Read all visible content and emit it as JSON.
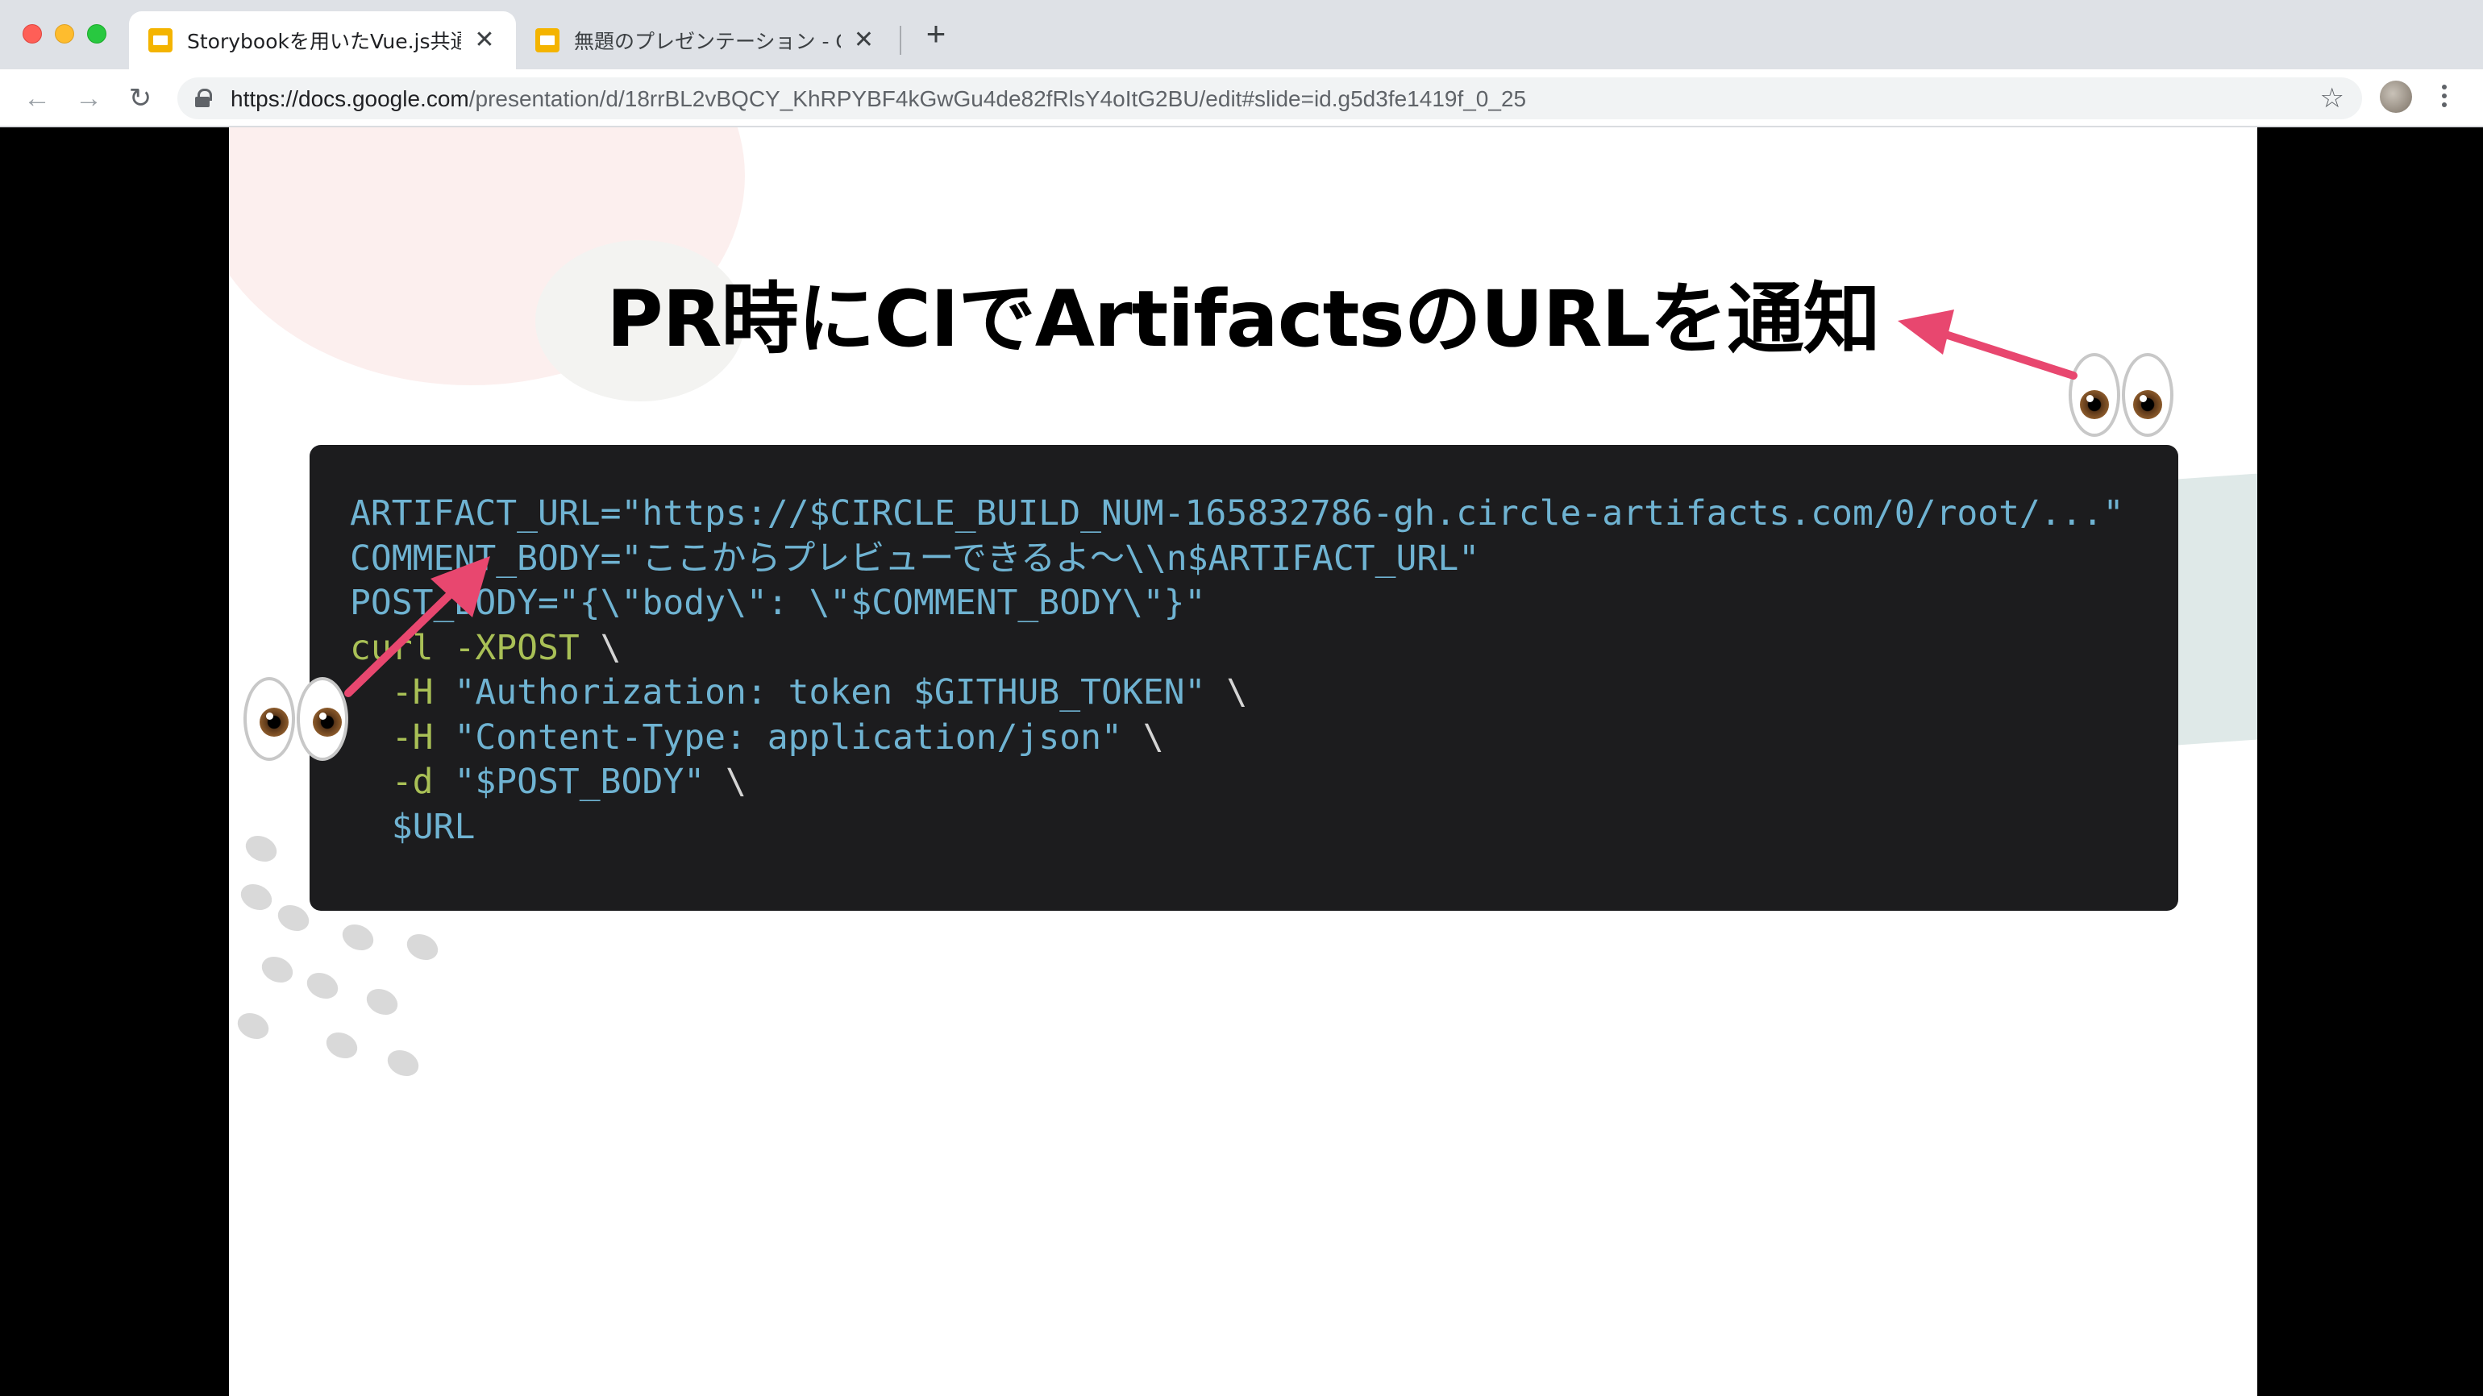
{
  "browser": {
    "tabs": [
      {
        "title": "Storybookを用いたVue.js共通コ",
        "active": true
      },
      {
        "title": "無題のプレゼンテーション - Goog",
        "active": false
      }
    ],
    "tab_close_glyph": "✕",
    "new_tab_glyph": "+",
    "url_host": "https://docs.google.com",
    "url_path": "/presentation/d/18rrBL2vBQCY_KhRPYBF4kGwGu4de82fRlsY4oItG2BU/edit#slide=id.g5d3fe1419f_0_25",
    "nav": {
      "back_icon": "←",
      "forward_icon": "→",
      "reload_icon": "↻",
      "star_icon": "☆"
    }
  },
  "slide": {
    "title": "PR時にCIでArtifactsのURLを通知",
    "code_lines": [
      [
        {
          "t": "ARTIFACT_URL=\"https://$CIRCLE_BUILD_NUM-165832786-gh.circle-artifacts.com/0/root/...\"",
          "c": "str"
        }
      ],
      [
        {
          "t": "COMMENT_BODY=\"ここからプレビューできるよ〜\\\\n$ARTIFACT_URL\"",
          "c": "str"
        }
      ],
      [
        {
          "t": "POST_BODY=\"{\\\"body\\\": \\\"$COMMENT_BODY\\\"}\"",
          "c": "str"
        }
      ],
      [
        {
          "t": "curl -XPOST",
          "c": "cmd"
        },
        {
          "t": " \\",
          "c": "txt"
        }
      ],
      [
        {
          "t": "  -H ",
          "c": "cmd"
        },
        {
          "t": "\"Authorization: token $GITHUB_TOKEN\"",
          "c": "str"
        },
        {
          "t": " \\",
          "c": "txt"
        }
      ],
      [
        {
          "t": "  -H ",
          "c": "cmd"
        },
        {
          "t": "\"Content-Type: application/json\"",
          "c": "str"
        },
        {
          "t": " \\",
          "c": "txt"
        }
      ],
      [
        {
          "t": "  -d ",
          "c": "cmd"
        },
        {
          "t": "\"$POST_BODY\"",
          "c": "str"
        },
        {
          "t": " \\",
          "c": "txt"
        }
      ],
      [
        {
          "t": "  $URL",
          "c": "str"
        }
      ]
    ],
    "decorations": [
      "eyes-emoji",
      "eyes-emoji",
      "pink-arrow",
      "pink-arrow"
    ]
  },
  "colors": {
    "code_bg": "#1c1c1e",
    "code_string": "#6fb3d2",
    "code_command": "#a9c056",
    "arrow": "#e8476f"
  }
}
